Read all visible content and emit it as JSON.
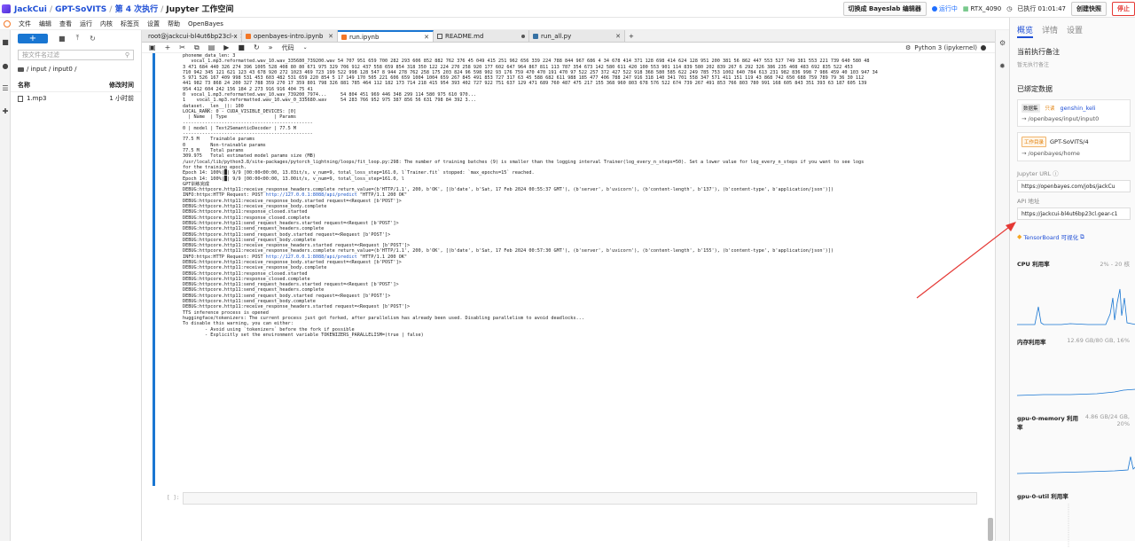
{
  "topbar": {
    "crumbs": [
      "JackCui",
      "GPT-SoVITS",
      "第 4 次执行",
      "Jupyter 工作空间"
    ],
    "switch_btn": "切换成 Bayeslab 编辑器",
    "status": "运行中",
    "gpu": "RTX_4090",
    "elapsed": "已执行 01:01:47",
    "snapshot_btn": "创建快照",
    "stop_btn": "停止"
  },
  "menubar": [
    "文件",
    "编辑",
    "查看",
    "运行",
    "内核",
    "标签页",
    "设置",
    "帮助",
    "OpenBayes"
  ],
  "filepanel": {
    "search_placeholder": "按文件名过滤",
    "path": "/ input / input0 /",
    "col_name": "名称",
    "col_modified": "修改时间",
    "files": [
      {
        "name": "1.mp3",
        "modified": "1 小时前"
      }
    ]
  },
  "tabs": [
    {
      "label": "root@jackcui-bl4ut6bp23cl-x",
      "icon": "terminal"
    },
    {
      "label": "openbayes-intro.ipynb",
      "icon": "notebook"
    },
    {
      "label": "run.ipynb",
      "icon": "notebook",
      "active": true
    },
    {
      "label": "README.md",
      "icon": "markdown",
      "dot": true
    },
    {
      "label": "run_all.py",
      "icon": "python"
    }
  ],
  "notebook": {
    "cell_type": "代码",
    "kernel": "Python 3 (ipykernel)",
    "prompt": "[ ]:",
    "output_lines": [
      "phoneme_data_len: 3",
      "   vocal_1.mp3.reformatted.wav_10.wav_335680_739200.wav 54 707 951 659 700 282 293 606 852 882 762 376 45 049 415 251 962 656 339 224 788 844 967 686 4 34 678 414 371 128 698 414 624 128 951 200 381 56 862 447 553 527 749 381 553 221 739 640 580 48",
      "3 471 684 440 326 274 396 1005 528 408 80 80 671 975 329 706 912 437 558 659 854 318 350 122 224 270 258 920 177 602 647 964 867 811 113 787 354 673 142 580 611 420 100 553 901 114 839 580 202 839 267 6 292 326 386 235 408 483 692 835 522 453",
      "710 942 345 121 621 123 43 678 920 272 1023 469 723 199 522 998 128 547 8 944 278 762 258 175 203 824 96 598 902 93 176 759 470 470 191 470 97 522 257 372 427 522 918 368 580 585 622 249 785 753 1002 640 784 613 231 982 836 998 7 986 459 40 103 947 34",
      "5 971 526 167 409 998 531 453 603 482 531 659 220 854 5 17 149 170 505 221 606 659 1004 1004 659 267 845 491 853 727 317 63 45 588 682 611 988 185 477 406 788 247 916 318 140 341 701 558 347 571 411 151 119 43 868 742 650 688 759 789 79 36 30 112",
      "441 982 73 868 24 200 327 788 359 270 17 359 801 798 326 881 785 464 112 182 173 714 218 415 954 393 402 727 922 751 637 129 471 689 760 487 475 217 155 368 960 803 678 576 522 674 739 267 491 853 766 803 780 991 168 605 843 351 393 63 187 605 139",
      "954 412 604 242 156 184 2 273 916 916 404 75 41",
      "0  vocal_1.mp3.reformatted.wav_10.wav_739200_7974...     54 804 451 969 446 348 299 114 580 975 610 970...",
      "1    vocal_1.mp3.reformatted.wav_10.wav_0_335680.wav     54 283 766 952 975 387 856 56 631 798 84 392 3...",
      "dataset.__len__(): 100",
      "LOCAL_RANK: 0 - CUDA_VISIBLE_DEVICES: [0]",
      "",
      "  | Name  | Type                 | Params",
      "-----------------------------------------------",
      "0 | model | Text2SemanticDecoder | 77.5 M",
      "-----------------------------------------------",
      "77.5 M    Trainable params",
      "0         Non-trainable params",
      "77.5 M    Total params",
      "309.975   Total estimated model params size (MB)",
      "/usr/local/lib/python3.8/site-packages/pytorch_lightning/loops/fit_loop.py:298: The number of training batches (9) is smaller than the logging interval Trainer(log_every_n_steps=50). Set a lower value for log_every_n_steps if you want to see logs",
      "for the training epoch.",
      "Epoch 14: 100%|█| 9/9 [00:00<00:00, 13.03it/s, v_num=9, total_loss_step=161.0, l`Trainer.fit` stopped: `max_epochs=15` reached.",
      "Epoch 14: 100%|█| 9/9 [00:00<00:00, 13.00it/s, v_num=9, total_loss_step=161.0, l",
      "GPT训练完成",
      "DEBUG:httpcore.http11:receive_response_headers.complete return_value=(b'HTTP/1.1', 200, b'OK', [(b'date', b'Sat, 17 Feb 2024 00:55:37 GMT'), (b'server', b'uvicorn'), (b'content-length', b'137'), (b'content-type', b'application/json')])",
      "INFO:httpx:HTTP Request: POST http://127.0.0.1:8088/api/predict \"HTTP/1.1 200 OK\"",
      "DEBUG:httpcore.http11:receive_response_body.started request=<Request [b'POST']>",
      "DEBUG:httpcore.http11:receive_response_body.complete",
      "DEBUG:httpcore.http11:response_closed.started",
      "DEBUG:httpcore.http11:response_closed.complete",
      "DEBUG:httpcore.http11:send_request_headers.started request=<Request [b'POST']>",
      "DEBUG:httpcore.http11:send_request_headers.complete",
      "DEBUG:httpcore.http11:send_request_body.started request=<Request [b'POST']>",
      "DEBUG:httpcore.http11:send_request_body.complete",
      "DEBUG:httpcore.http11:receive_response_headers.started request=<Request [b'POST']>",
      "DEBUG:httpcore.http11:receive_response_headers.complete return_value=(b'HTTP/1.1', 200, b'OK', [(b'date', b'Sat, 17 Feb 2024 00:57:30 GMT'), (b'server', b'uvicorn'), (b'content-length', b'155'), (b'content-type', b'application/json')])",
      "INFO:httpx:HTTP Request: POST http://127.0.0.1:8088/api/predict \"HTTP/1.1 200 OK\"",
      "DEBUG:httpcore.http11:receive_response_body.started request=<Request [b'POST']>",
      "DEBUG:httpcore.http11:receive_response_body.complete",
      "DEBUG:httpcore.http11:response_closed.started",
      "DEBUG:httpcore.http11:response_closed.complete",
      "DEBUG:httpcore.http11:send_request_headers.started request=<Request [b'POST']>",
      "DEBUG:httpcore.http11:send_request_headers.complete",
      "DEBUG:httpcore.http11:send_request_body.started request=<Request [b'POST']>",
      "DEBUG:httpcore.http11:send_request_body.complete",
      "DEBUG:httpcore.http11:receive_response_headers.started request=<Request [b'POST']>",
      "TTS inference process is opened",
      "huggingface/tokenizers: The current process just got forked, after parallelism has already been used. Disabling parallelism to avoid deadlocks...",
      "To disable this warning, you can either:",
      "        - Avoid using `tokenizers` before the fork if possible",
      "        - Explicitly set the environment variable TOKENIZERS_PARALLELISM=(true | false)"
    ]
  },
  "rightpanel": {
    "tabs": [
      "概览",
      "详情",
      "设置"
    ],
    "notes_title": "当前执行备注",
    "notes_empty": "暂无执行备注",
    "bound_title": "已绑定数据",
    "dataset": {
      "tag": "数据集",
      "tag2": "只读",
      "name": "genshin_keli",
      "path": "→ /openbayes/input/input0"
    },
    "workdir": {
      "tag": "工作目录",
      "name": "GPT-SoVITS/4",
      "path": "→ /openbayes/home"
    },
    "jupyter_url_label": "Jupyter URL ⓘ",
    "jupyter_url": "https://openbayes.com/jobs/jackCu",
    "api_label": "API 地址",
    "api_url": "https://jackcui-bl4ut6bp23cl.gear-c1",
    "tensorboard": "TensorBoard 可视化",
    "cpu_label": "CPU 利用率",
    "cpu_value": "2% - 20 核",
    "mem_label": "内存利用率",
    "mem_value": "12.69 GB/80 GB, 16%",
    "gpumem_label": "gpu-0-memory 利用率",
    "gpumem_value": "4.86 GB/24 GB, 20%",
    "gpuutil_label": "gpu-0-util 利用率"
  },
  "colors": {
    "accent": "#1f4fd6",
    "cell_bar": "#1976d2",
    "stop": "#e53935",
    "arrow": "#e53935"
  }
}
